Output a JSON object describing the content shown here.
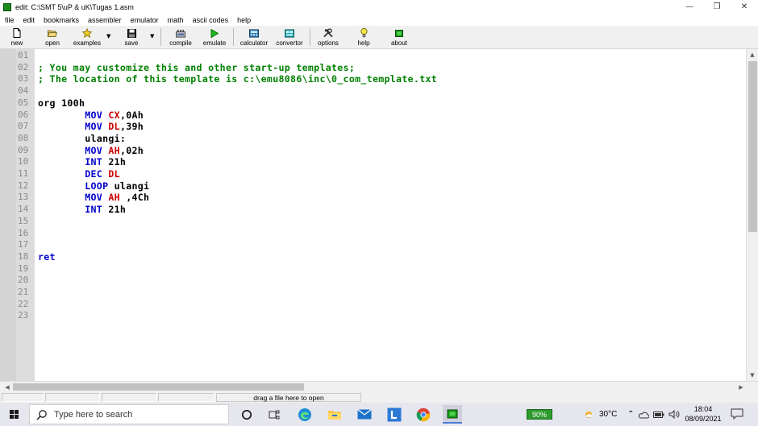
{
  "window": {
    "title": "edit: C:\\SMT 5\\uP & uK\\Tugas 1.asm",
    "minimize": "—",
    "maximize": "❐",
    "close": "✕"
  },
  "menu": [
    "file",
    "edit",
    "bookmarks",
    "assembler",
    "emulator",
    "math",
    "ascii codes",
    "help"
  ],
  "toolbar": {
    "new": "new",
    "open": "open",
    "examples": "examples",
    "save": "save",
    "compile": "compile",
    "emulate": "emulate",
    "calculator": "calculator",
    "convertor": "convertor",
    "options": "options",
    "help": "help",
    "about": "about"
  },
  "editor": {
    "line_numbers": [
      "01",
      "02",
      "03",
      "04",
      "05",
      "06",
      "07",
      "08",
      "09",
      "10",
      "11",
      "12",
      "13",
      "14",
      "15",
      "16",
      "17",
      "18",
      "19",
      "20",
      "21",
      "22",
      "23"
    ],
    "lines": [
      {
        "tokens": []
      },
      {
        "tokens": [
          {
            "t": "; You may customize this and other start-up templates;",
            "c": "comment"
          }
        ]
      },
      {
        "tokens": [
          {
            "t": "; The location of this template is c:\\emu8086\\inc\\0_com_template.txt",
            "c": "comment"
          }
        ]
      },
      {
        "tokens": []
      },
      {
        "tokens": [
          {
            "t": "org 100h",
            "c": "plain"
          }
        ]
      },
      {
        "tokens": [
          {
            "t": "        ",
            "c": "plain"
          },
          {
            "t": "MOV",
            "c": "keyword"
          },
          {
            "t": " ",
            "c": "plain"
          },
          {
            "t": "CX",
            "c": "register"
          },
          {
            "t": ",0Ah",
            "c": "plain"
          }
        ]
      },
      {
        "tokens": [
          {
            "t": "        ",
            "c": "plain"
          },
          {
            "t": "MOV",
            "c": "keyword"
          },
          {
            "t": " ",
            "c": "plain"
          },
          {
            "t": "DL",
            "c": "register"
          },
          {
            "t": ",39h",
            "c": "plain"
          }
        ]
      },
      {
        "tokens": [
          {
            "t": "        ulangi:",
            "c": "plain"
          }
        ]
      },
      {
        "tokens": [
          {
            "t": "        ",
            "c": "plain"
          },
          {
            "t": "MOV",
            "c": "keyword"
          },
          {
            "t": " ",
            "c": "plain"
          },
          {
            "t": "AH",
            "c": "register"
          },
          {
            "t": ",02h",
            "c": "plain"
          }
        ]
      },
      {
        "tokens": [
          {
            "t": "        ",
            "c": "plain"
          },
          {
            "t": "INT",
            "c": "keyword"
          },
          {
            "t": " 21h",
            "c": "plain"
          }
        ]
      },
      {
        "tokens": [
          {
            "t": "        ",
            "c": "plain"
          },
          {
            "t": "DEC",
            "c": "keyword"
          },
          {
            "t": " ",
            "c": "plain"
          },
          {
            "t": "DL",
            "c": "register"
          }
        ]
      },
      {
        "tokens": [
          {
            "t": "        ",
            "c": "plain"
          },
          {
            "t": "LOOP",
            "c": "keyword"
          },
          {
            "t": " ulangi",
            "c": "plain"
          }
        ]
      },
      {
        "tokens": [
          {
            "t": "        ",
            "c": "plain"
          },
          {
            "t": "MOV",
            "c": "keyword"
          },
          {
            "t": " ",
            "c": "plain"
          },
          {
            "t": "AH",
            "c": "register"
          },
          {
            "t": " ,4Ch",
            "c": "plain"
          }
        ]
      },
      {
        "tokens": [
          {
            "t": "        ",
            "c": "plain"
          },
          {
            "t": "INT",
            "c": "keyword"
          },
          {
            "t": " 21h",
            "c": "plain"
          }
        ]
      },
      {
        "tokens": []
      },
      {
        "tokens": []
      },
      {
        "tokens": []
      },
      {
        "tokens": [
          {
            "t": "ret",
            "c": "keyword"
          }
        ]
      },
      {
        "tokens": []
      },
      {
        "tokens": []
      },
      {
        "tokens": []
      },
      {
        "tokens": []
      },
      {
        "tokens": []
      }
    ]
  },
  "status": {
    "hint": "drag a file here to open"
  },
  "taskbar": {
    "search_placeholder": "Type here to search",
    "battery": "90%",
    "weather": "30°C",
    "time": "18:04",
    "date": "08/09/2021"
  },
  "colors": {
    "comment": "#008000",
    "keyword": "#0000cc",
    "register": "#cc0000",
    "plain": "#000000",
    "app_accent": "#1e8a1e"
  }
}
